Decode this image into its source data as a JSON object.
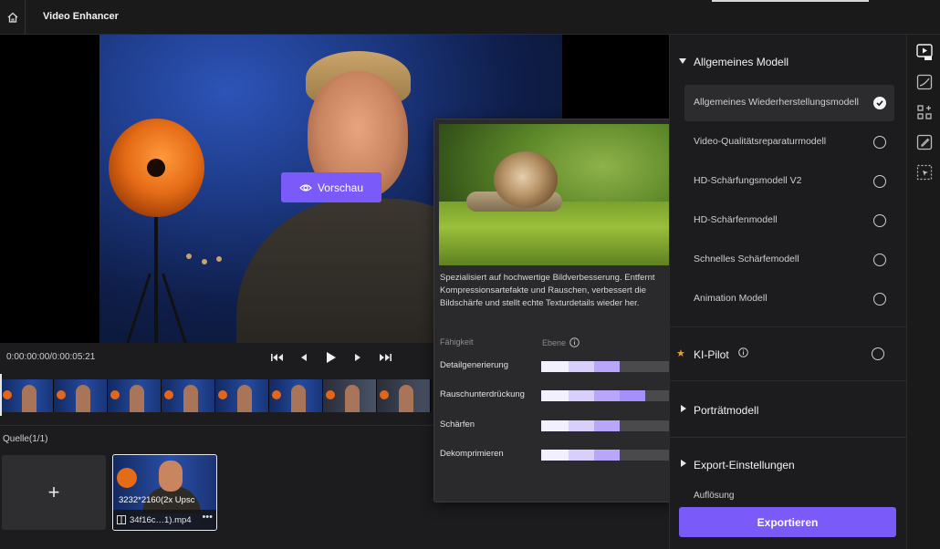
{
  "header": {
    "title": "Video Enhancer"
  },
  "preview": {
    "button_label": "Vorschau"
  },
  "playback": {
    "timecode": "0:00:00:00/0:00:05:21"
  },
  "sources": {
    "label": "Quelle(1/1)",
    "add_label": "+",
    "file": {
      "resolution": "3232*2160(2x Upsc",
      "name": "34f16c…1).mp4",
      "more": "•••"
    }
  },
  "tooltip": {
    "description": "Spezialisiert auf hochwertige Bildverbesserung. Entfernt Kompressionsartefakte und Rauschen, verbessert die Bildschärfe und stellt echte Texturdetails wieder her.",
    "col_ability": "Fähigkeit",
    "col_level": "Ebene",
    "skills": [
      {
        "label": "Detailgenerierung",
        "level": 3
      },
      {
        "label": "Rauschunterdrückung",
        "level": 4
      },
      {
        "label": "Schärfen",
        "level": 3
      },
      {
        "label": "Dekomprimieren",
        "level": 3
      }
    ],
    "level_max": 5
  },
  "panel": {
    "general_model": {
      "title": "Allgemeines Modell",
      "items": [
        {
          "label": "Allgemeines Wiederherstellungsmodell",
          "selected": true
        },
        {
          "label": "Video-Qualitätsreparaturmodell",
          "selected": false
        },
        {
          "label": "HD-Schärfungsmodell V2",
          "selected": false
        },
        {
          "label": "HD-Schärfenmodell",
          "selected": false
        },
        {
          "label": "Schnelles Schärfemodell",
          "selected": false
        },
        {
          "label": "Animation Modell",
          "selected": false
        }
      ]
    },
    "ai_pilot": {
      "title": "KI-Pilot"
    },
    "portrait": {
      "title": "Porträtmodell"
    },
    "export_settings": {
      "title": "Export-Einstellungen",
      "resolution_label": "Auflösung"
    },
    "export_button": "Exportieren"
  },
  "colors": {
    "accent": "#7a5af8",
    "bar_seg1": "#f2f0ff",
    "bar_seg2": "#d8cffd",
    "bar_seg3": "#b9a6fb",
    "bar_seg4": "#a58ffa",
    "bar_empty": "#4a4a4c"
  },
  "icons": {
    "home": "home-icon",
    "preview": "eye-icon",
    "ai_star": "star-icon",
    "side": [
      "uhd-video-icon",
      "curve-icon",
      "shapes-icon",
      "edit-icon",
      "select-area-icon"
    ]
  }
}
